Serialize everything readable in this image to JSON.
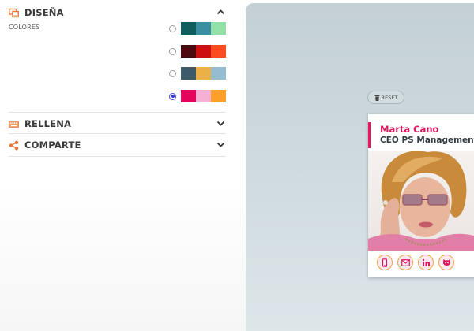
{
  "sections": {
    "disena": {
      "title": "DISEÑA",
      "icon": "monitor-icon"
    },
    "rellena": {
      "title": "RELLENA",
      "icon": "keyboard-icon"
    },
    "comparte": {
      "title": "COMPARTE",
      "icon": "share-icon"
    }
  },
  "colores_label": "COLORES",
  "palettes": [
    {
      "selected": false,
      "colors": [
        "#0e5c5b",
        "#3a8f9f",
        "#94e0a9"
      ]
    },
    {
      "selected": false,
      "colors": [
        "#4a0a0e",
        "#cc0f0f",
        "#fb4c1f"
      ]
    },
    {
      "selected": false,
      "colors": [
        "#3d5a69",
        "#ecb144",
        "#94bdd1"
      ]
    },
    {
      "selected": true,
      "colors": [
        "#e5045c",
        "#f8afd4",
        "#fd9f28"
      ]
    }
  ],
  "preview": {
    "reset_label": "RESET",
    "card": {
      "name": "Marta Cano",
      "role": "CEO PS Management",
      "accent_color": "#e8155f",
      "socials": [
        "phone-icon",
        "email-icon",
        "linkedin-icon",
        "github-icon"
      ]
    }
  }
}
